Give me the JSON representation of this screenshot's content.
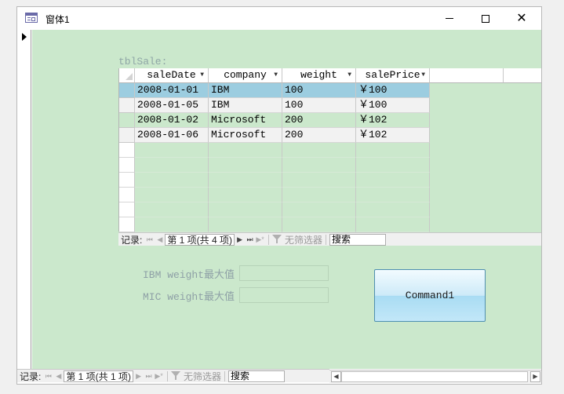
{
  "window": {
    "title": "窗体1"
  },
  "subform": {
    "label": "tblSale:",
    "columns": [
      "saleDate",
      "company",
      "weight",
      "salePrice"
    ],
    "rows": [
      [
        "2008-01-01",
        "IBM",
        "100",
        "￥100"
      ],
      [
        "2008-01-05",
        "IBM",
        "100",
        "￥100"
      ],
      [
        "2008-01-02",
        "Microsoft",
        "200",
        "￥102"
      ],
      [
        "2008-01-06",
        "Microsoft",
        "200",
        "￥102"
      ]
    ],
    "navigator": {
      "record_label": "记录:",
      "position": "第 1 项(共 4 项)",
      "filter": "无筛选器",
      "search": "搜索"
    }
  },
  "fields": {
    "ibm_label": "IBM weight最大值",
    "mic_label": "MIC weight最大值",
    "ibm_value": "",
    "mic_value": ""
  },
  "command_button": {
    "label": "Command1"
  },
  "main_navigator": {
    "record_label": "记录:",
    "position": "第 1 项(共 1 项)",
    "filter": "无筛选器",
    "search": "搜索"
  },
  "colors": {
    "form_background": "#cbe8cc",
    "selected_row": "#9ccde0",
    "button_border": "#4f8fb0"
  }
}
